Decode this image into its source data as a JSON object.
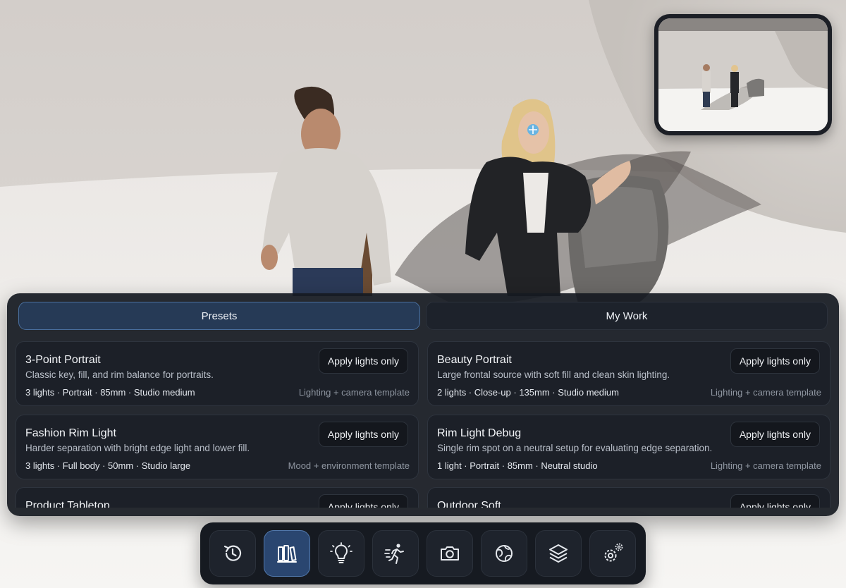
{
  "panel": {
    "tabs": [
      {
        "label": "Presets",
        "active": true
      },
      {
        "label": "My Work",
        "active": false
      }
    ],
    "cards": [
      {
        "title": "3-Point Portrait",
        "description": "Classic key, fill, and rim balance for portraits.",
        "meta": "3 lights · Portrait · 85mm · Studio medium",
        "template": "Lighting + camera template",
        "button": "Apply lights only"
      },
      {
        "title": "Beauty Portrait",
        "description": "Large frontal source with soft fill and clean skin lighting.",
        "meta": "2 lights · Close-up · 135mm · Studio medium",
        "template": "Lighting + camera template",
        "button": "Apply lights only"
      },
      {
        "title": "Fashion Rim Light",
        "description": "Harder separation with bright edge light and lower fill.",
        "meta": "3 lights · Full body · 50mm · Studio large",
        "template": "Mood + environment template",
        "button": "Apply lights only"
      },
      {
        "title": "Rim Light Debug",
        "description": "Single rim spot on a neutral setup for evaluating edge separation.",
        "meta": "1 light · Portrait · 85mm · Neutral studio",
        "template": "Lighting + camera template",
        "button": "Apply lights only"
      },
      {
        "title": "Product Tabletop",
        "description": "",
        "meta": "",
        "template": "",
        "button": "Apply lights only"
      },
      {
        "title": "Outdoor Soft",
        "description": "",
        "meta": "",
        "template": "",
        "button": "Apply lights only"
      }
    ]
  },
  "toolbar": {
    "tools": [
      {
        "icon": "history-icon",
        "active": false
      },
      {
        "icon": "library-icon",
        "active": true
      },
      {
        "icon": "light-bulb-icon",
        "active": false
      },
      {
        "icon": "pose-icon",
        "active": false
      },
      {
        "icon": "camera-icon",
        "active": false
      },
      {
        "icon": "globe-icon",
        "active": false
      },
      {
        "icon": "layers-icon",
        "active": false
      },
      {
        "icon": "settings-icon",
        "active": false
      }
    ]
  },
  "colors": {
    "panel_bg": "#161a21",
    "accent": "#2a4670",
    "accent_border": "#5279ad"
  }
}
